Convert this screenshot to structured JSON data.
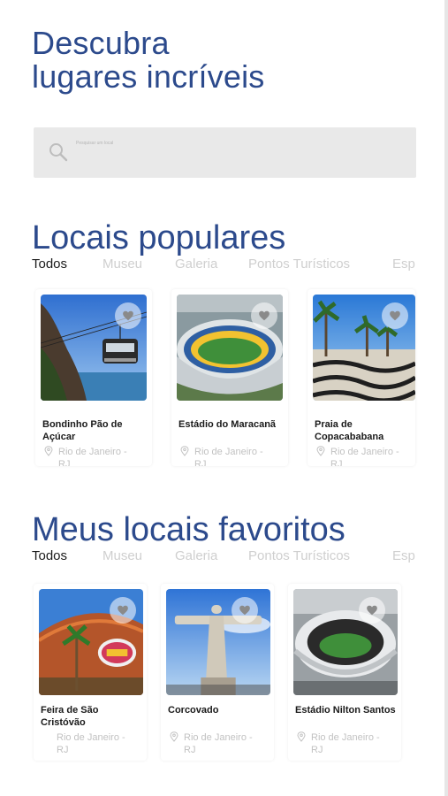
{
  "hero": {
    "line1": "Descubra",
    "line2": "lugares incríveis"
  },
  "search": {
    "placeholder": "Pesquisar um local"
  },
  "popular": {
    "title": "Locais populares",
    "tabs": [
      "Todos",
      "Museu",
      "Galeria",
      "Pontos Turísticos",
      "Esp"
    ],
    "active_tab": "Todos",
    "cards": [
      {
        "name": "Bondinho Pão de Açúcar",
        "location": "Rio de Janeiro - RJ",
        "favorite_icon": "heart-icon"
      },
      {
        "name": "Estádio do Maracanã",
        "location": "Rio de Janeiro - RJ",
        "favorite_icon": "heart-icon"
      },
      {
        "name": "Praia de Copacababana",
        "location": "Rio de Janeiro - RJ",
        "favorite_icon": "heart-icon"
      }
    ]
  },
  "favorites": {
    "title": "Meus locais favoritos",
    "tabs": [
      "Todos",
      "Museu",
      "Galeria",
      "Pontos Turísticos",
      "Esp"
    ],
    "active_tab": "Todos",
    "cards": [
      {
        "name": "Feira de São Cristóvão",
        "location": "Rio de Janeiro - RJ",
        "favorite_icon": "heart-icon"
      },
      {
        "name": "Corcovado",
        "location": "Rio de Janeiro - RJ",
        "favorite_icon": "heart-icon"
      },
      {
        "name": "Estádio Nilton Santos",
        "location": "Rio de Janeiro - RJ",
        "favorite_icon": "heart-icon"
      }
    ]
  },
  "colors": {
    "accent": "#2c4a8c",
    "muted_tab": "#cfcfcf",
    "search_bg": "#e9e9e9"
  }
}
